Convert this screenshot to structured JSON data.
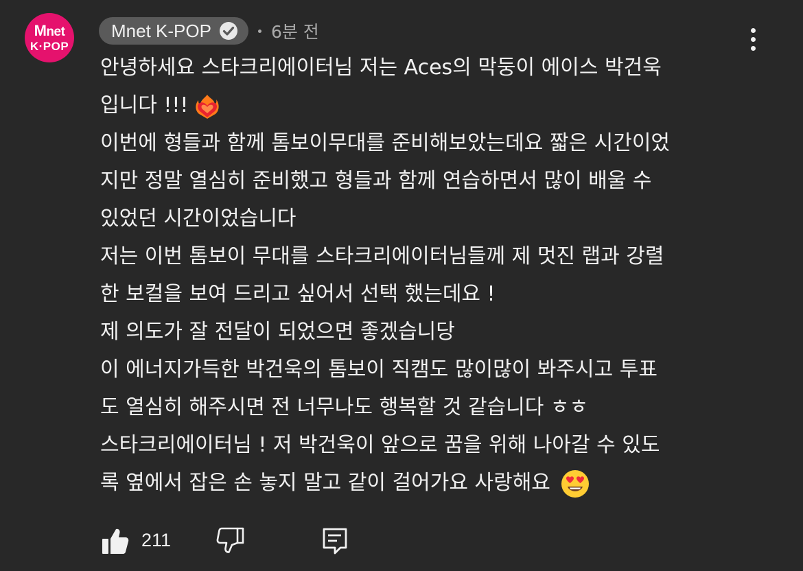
{
  "avatar": {
    "line1_m": "M",
    "line1_rest": "net",
    "line2": "K·POP",
    "color": "#e5126d"
  },
  "comment": {
    "author": "Mnet K-POP",
    "verified": true,
    "time": "6분 전",
    "lines": [
      "안녕하세요 스타크리에이터님 저는 Aces의 막둥이 에이스 박건욱",
      "입니다 !!!",
      "이번에 형들과 함께 톰보이무대를 준비해보았는데요 짧은 시간이었",
      "지만 정말 열심히 준비했고 형들과 함께 연습하면서 많이 배울 수",
      "있었던 시간이었습니다",
      "저는 이번 톰보이 무대를 스타크리에이터님들께 제 멋진 랩과 강렬",
      "한 보컬을 보여 드리고 싶어서 선택 했는데요 !",
      "제 의도가 잘 전달이 되었으면 좋겠습니당",
      "이 에너지가득한 박건욱의 톰보이 직캠도 많이많이 봐주시고 투표",
      "도 열심히 해주시면 전 너무나도 행복할 것 같습니다 ㅎㅎ",
      "스타크리에이터님 ! 저 박건욱이 앞으로 꿈을 위해 나아갈 수 있도",
      "록 옆에서 잡은 손 놓지 말고 같이 걸어가요 사랑해요"
    ],
    "emojis": {
      "line2": "heart-on-fire-icon",
      "line12": "heart-eyes-icon"
    }
  },
  "actions": {
    "likes": "211"
  },
  "colors": {
    "background": "#282828",
    "text": "#f1f1f1",
    "secondary": "#aaaaaa",
    "pill": "#5a5a5a"
  }
}
